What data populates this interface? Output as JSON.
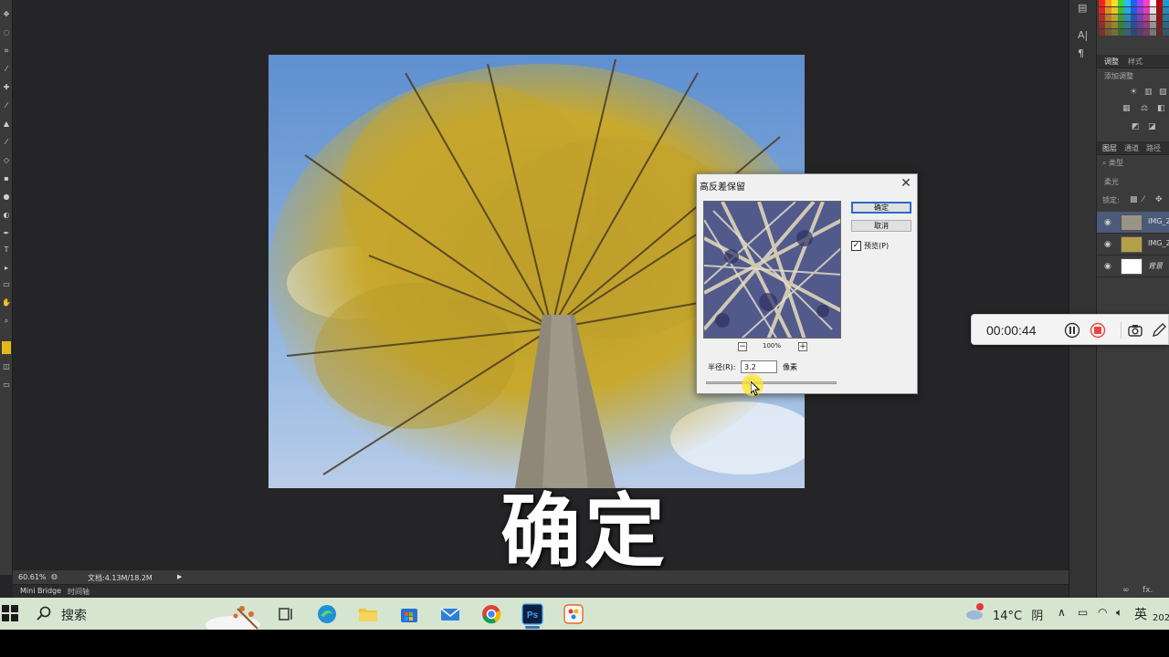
{
  "app": {
    "name": "Photoshop"
  },
  "status_bar": {
    "zoom": "60.61%",
    "doc_info": "文档:4.13M/18.2M",
    "tabs": [
      "Mini Bridge",
      "时间轴"
    ]
  },
  "right_panels": {
    "top_tabs": [
      "调整",
      "样式"
    ],
    "adjust_label": "添加调整",
    "layer_tabs": [
      "图层",
      "通道",
      "路径"
    ],
    "kind_filter": "类型",
    "blend_mode": "柔光",
    "lock_label": "锁定:",
    "layers": [
      {
        "name": "IMG_2",
        "selected": true
      },
      {
        "name": "IMG_2",
        "selected": false
      },
      {
        "name": "背景",
        "selected": false
      }
    ]
  },
  "dialog": {
    "title": "高反差保留",
    "ok_label": "确定",
    "cancel_label": "取消",
    "preview_label": "预览(P)",
    "preview_checked": true,
    "zoom_level": "100%",
    "radius_label": "半径(R):",
    "radius_value": "3.2",
    "radius_unit": "像素",
    "radius_fraction": 0.35
  },
  "recorder": {
    "time": "00:00:44"
  },
  "subtitle": "确定",
  "taskbar": {
    "search_text": "搜索",
    "apps": [
      "task-view",
      "edge",
      "file-explorer",
      "store",
      "mail",
      "chrome",
      "photoshop",
      "paint"
    ],
    "active_app": "photoshop",
    "temperature": "14°C",
    "weather": "阴",
    "input_lang": "英",
    "clock": "202"
  },
  "colors": {
    "ps_bg": "#252527",
    "dialog_bg": "#f0f0f0",
    "accent": "#2c6ac7",
    "recorder_stop": "#e8473f",
    "taskbar": "#d6e5cf"
  }
}
